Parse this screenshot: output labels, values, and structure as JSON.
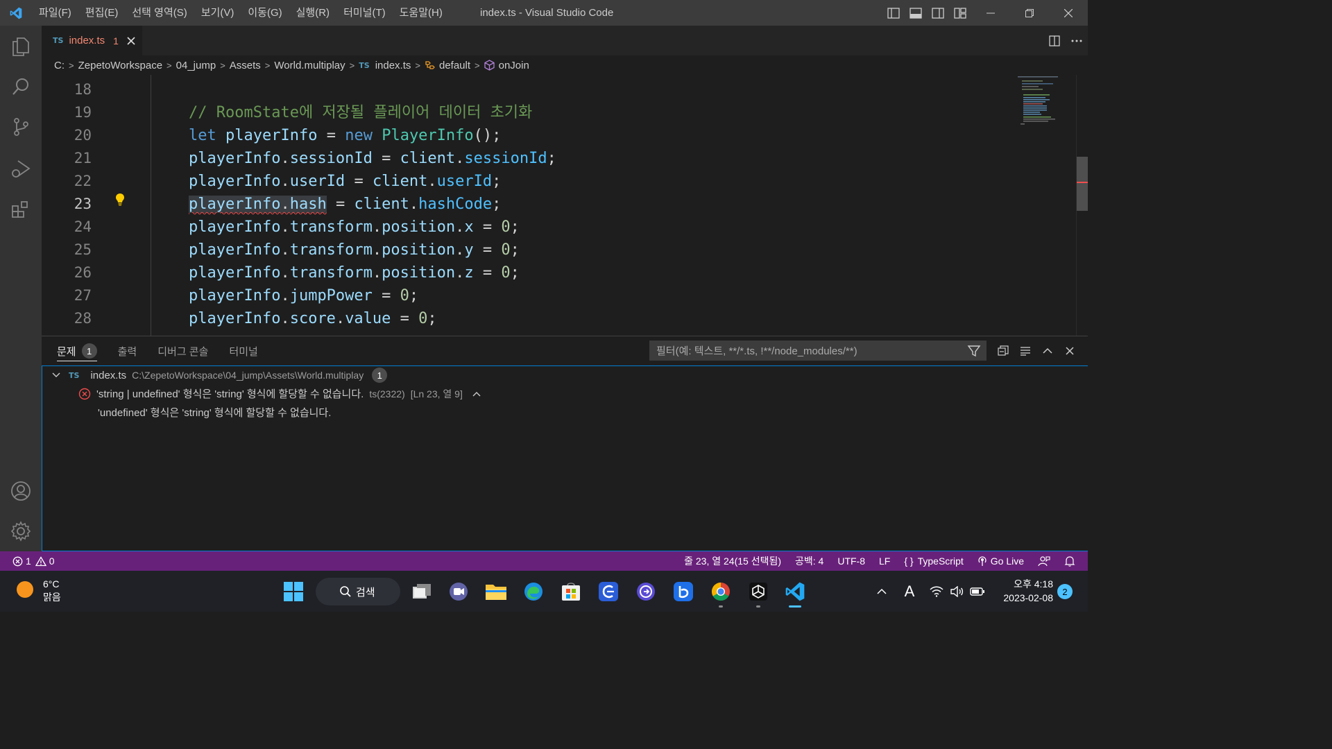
{
  "titlebar": {
    "menu": [
      "파일(F)",
      "편집(E)",
      "선택 영역(S)",
      "보기(V)",
      "이동(G)",
      "실행(R)",
      "터미널(T)",
      "도움말(H)"
    ],
    "title": "index.ts - Visual Studio Code"
  },
  "tab": {
    "badge": "TS",
    "name": "index.ts",
    "problem_count": "1"
  },
  "breadcrumb": {
    "items": [
      "C:",
      "ZepetoWorkspace",
      "04_jump",
      "Assets",
      "World.multiplay"
    ],
    "file_badge": "TS",
    "file": "index.ts",
    "symbol1": "default",
    "symbol2": "onJoin"
  },
  "editor": {
    "active_line": 23,
    "line_numbers": [
      "18",
      "19",
      "20",
      "21",
      "22",
      "23",
      "24",
      "25",
      "26",
      "27",
      "28"
    ],
    "lines": [
      "",
      "// RoomState에 저장될 플레이어 데이터 초기화",
      "let playerInfo = new PlayerInfo();",
      "playerInfo.sessionId = client.sessionId;",
      "playerInfo.userId = client.userId;",
      "playerInfo.hash = client.hashCode;",
      "playerInfo.transform.position.x = 0;",
      "playerInfo.transform.position.y = 0;",
      "playerInfo.transform.position.z = 0;",
      "playerInfo.jumpPower = 0;",
      "playerInfo.score.value = 0;"
    ]
  },
  "panel": {
    "tabs": [
      "문제",
      "출력",
      "디버그 콘솔",
      "터미널"
    ],
    "problems_count": "1",
    "filter_placeholder": "필터(예: 텍스트, **/*.ts, !**/node_modules/**)",
    "file": {
      "badge": "TS",
      "name": "index.ts",
      "path": "C:\\ZepetoWorkspace\\04_jump\\Assets\\World.multiplay",
      "count": "1"
    },
    "error": {
      "message": "'string | undefined' 형식은 'string' 형식에 할당할 수 없습니다.",
      "code": "ts(2322)",
      "location": "[Ln 23, 열 9]",
      "detail": "'undefined' 형식은 'string' 형식에 할당할 수 없습니다."
    }
  },
  "statusbar": {
    "errors": "1",
    "warnings": "0",
    "cursor": "줄 23, 열 24(15 선택됨)",
    "spaces": "공백: 4",
    "encoding": "UTF-8",
    "eol": "LF",
    "language": "TypeScript",
    "golive": "Go Live"
  },
  "taskbar": {
    "temperature": "6°C",
    "weather": "맑음",
    "search": "검색",
    "ime": "A",
    "time": "오후 4:18",
    "date": "2023-02-08",
    "notifications": "2"
  },
  "colors": {
    "statusbar": "#68217a",
    "error": "#f14c4c",
    "accent": "#007acc"
  }
}
